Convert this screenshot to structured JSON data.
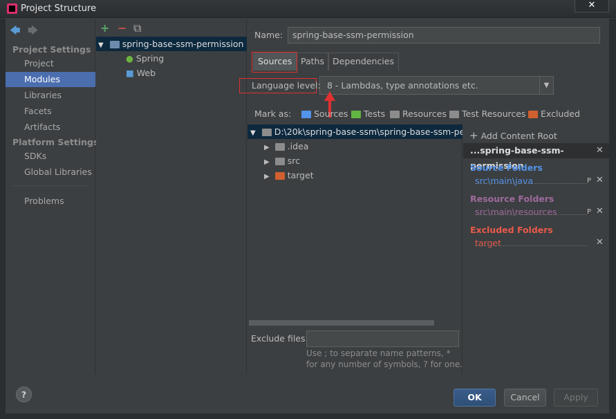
{
  "window": {
    "title": "Project Structure",
    "close": "✕"
  },
  "nav": {
    "back": "🡄",
    "forward": "🡆",
    "project_settings": "Project Settings",
    "project_items": [
      "Project",
      "Modules",
      "Libraries",
      "Facets",
      "Artifacts"
    ],
    "platform_settings": "Platform Settings",
    "platform_items": [
      "SDKs",
      "Global Libraries"
    ],
    "problems": "Problems",
    "selected": "Modules"
  },
  "modules": {
    "toolbar": {
      "add": "+",
      "remove": "−",
      "copy": "⧉"
    },
    "root": "spring-base-ssm-permission",
    "children": [
      "Spring",
      "Web"
    ]
  },
  "editor": {
    "name_label": "Name:",
    "name_value": "spring-base-ssm-permission",
    "tabs": [
      "Sources",
      "Paths",
      "Dependencies"
    ],
    "active_tab": "Sources",
    "language_level_label": "Language level:",
    "language_level_value": "8 - Lambdas, type annotations etc.",
    "mark_as_label": "Mark as:",
    "mark_as": [
      "Sources",
      "Tests",
      "Resources",
      "Test Resources",
      "Excluded"
    ],
    "tree_root": "D:\\20k\\spring-base-ssm\\spring-base-ssm-permission",
    "tree_children": [
      ".idea",
      "src",
      "target"
    ],
    "exclude_label": "Exclude files:",
    "exclude_value": "",
    "hint1": "Use ; to separate name patterns, *",
    "hint2": "for any number of symbols, ? for one."
  },
  "content_root": {
    "add_label": "Add Content Root",
    "header": "...spring-base-ssm-permission",
    "source_title": "Source Folders",
    "source_path": "src\\main\\java",
    "resource_title": "Resource Folders",
    "resource_path": "src\\main\\resources",
    "excluded_title": "Excluded Folders",
    "excluded_path": "target",
    "colors": {
      "source": "#5394ec",
      "resource": "#9e6a9e",
      "excluded": "#e8594a"
    }
  },
  "buttons": {
    "help": "?",
    "ok": "OK",
    "cancel": "Cancel",
    "apply": "Apply"
  }
}
